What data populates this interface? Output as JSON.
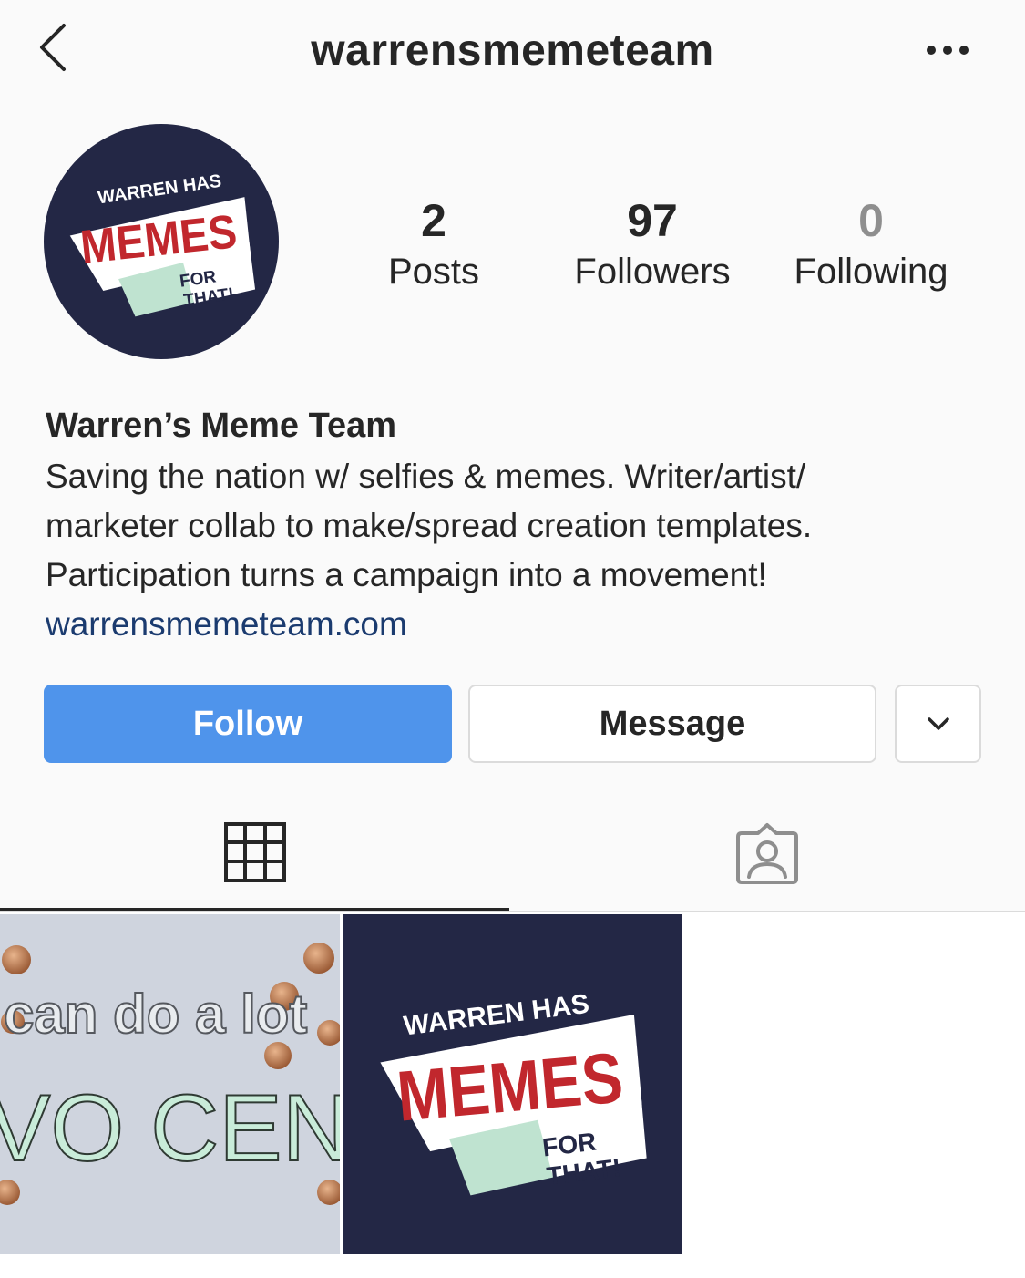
{
  "header": {
    "username": "warrensmemeteam",
    "back_icon": "chevron-left-icon",
    "more_icon": "more-horizontal-icon"
  },
  "profile": {
    "avatar_logo": {
      "line1": "WARREN HAS",
      "line2": "MEMES",
      "line3": "FOR",
      "line4": "THAT!"
    },
    "stats": {
      "posts_count": "2",
      "posts_label": "Posts",
      "followers_count": "97",
      "followers_label": "Followers",
      "following_count": "0",
      "following_label": "Following"
    },
    "display_name": "Warren’s Meme Team",
    "bio_line1": "Saving the nation w/ selfies & memes. Writer/artist/",
    "bio_line2": "marketer collab to make/spread creation templates.",
    "bio_line3": "Participation turns a campaign into a movement!",
    "website": "warrensmemeteam.com"
  },
  "actions": {
    "follow_label": "Follow",
    "message_label": "Message",
    "more_icon": "chevron-down-icon"
  },
  "tabs": {
    "grid_icon": "grid-icon",
    "tagged_icon": "tagged-person-icon",
    "active": "grid"
  },
  "posts": [
    {
      "line1": "can do a lot",
      "line2": "VO CEN"
    },
    {
      "line1": "WARREN HAS",
      "line2": "MEMES",
      "line3": "FOR",
      "line4": "THAT!"
    }
  ],
  "colors": {
    "follow_button": "#4f94eb",
    "link": "#1b3b6f",
    "logo_navy": "#232745",
    "logo_red": "#c1272d",
    "logo_mint": "#bfe3d0"
  }
}
